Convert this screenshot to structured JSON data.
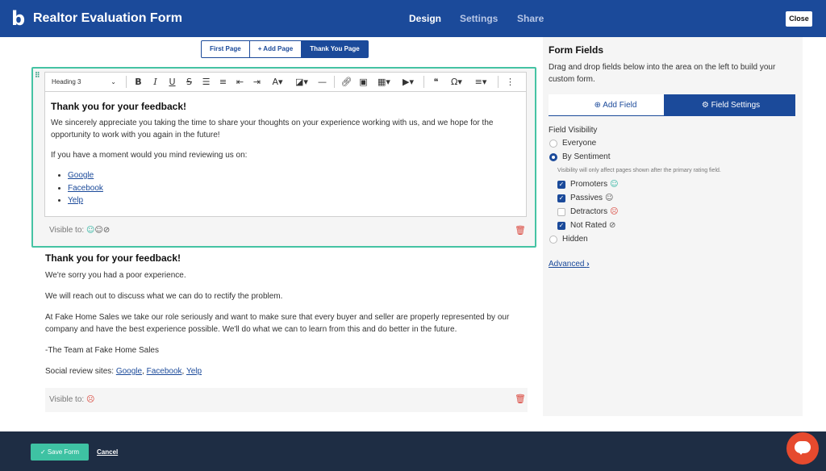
{
  "header": {
    "logo": "b",
    "title": "Realtor Evaluation Form",
    "nav": [
      "Design",
      "Settings",
      "Share"
    ],
    "active_nav": "Design",
    "close": "Close"
  },
  "page_tabs": [
    "First Page",
    "+ Add Page",
    "Thank You Page"
  ],
  "selected_page_tab": "Thank You Page",
  "editor": {
    "heading_select": "Heading 3",
    "heading": "Thank you for your feedback!",
    "para1": "We sincerely appreciate you taking the time to share your thoughts on your experience working with us, and we hope for the opportunity to work with you again in the future!",
    "para2": "If you have a moment would you mind reviewing us on:",
    "links": [
      "Google",
      "Facebook",
      "Yelp"
    ],
    "visible_to": "Visible to:"
  },
  "block2": {
    "heading": "Thank you for your feedback!",
    "p1": "We're sorry you had a poor experience.",
    "p2": "We will reach out to discuss what we can do to rectify the problem.",
    "p3": "At Fake Home Sales we take our role seriously and want to make sure that every buyer and seller are properly represented by our company and have the best experience possible.  We'll do what we can to learn from this and do better in the future.",
    "p4": "-The Team at Fake Home Sales",
    "social_label": "Social review sites:",
    "social_links": [
      "Google",
      "Facebook",
      "Yelp"
    ],
    "sep": ", ",
    "visible_to": "Visible to:"
  },
  "sidebar": {
    "title": "Form Fields",
    "desc": "Drag and drop fields below into the area on the left to build your custom form.",
    "tab_add": "Add Field",
    "tab_settings": "Field Settings",
    "visibility_label": "Field Visibility",
    "opt_everyone": "Everyone",
    "opt_sentiment": "By Sentiment",
    "hint": "Visibility will only affect pages shown after the primary rating field.",
    "chk_promoters": "Promoters",
    "chk_passives": "Passives",
    "chk_detractors": "Detractors",
    "chk_not_rated": "Not Rated",
    "opt_hidden": "Hidden",
    "advanced": "Advanced"
  },
  "footer": {
    "save": "Save Form",
    "cancel": "Cancel"
  },
  "colors": {
    "brand": "#1b4a9a",
    "accent_green": "#45c3a3",
    "danger": "#d9443a",
    "footer": "#1e2d44"
  }
}
